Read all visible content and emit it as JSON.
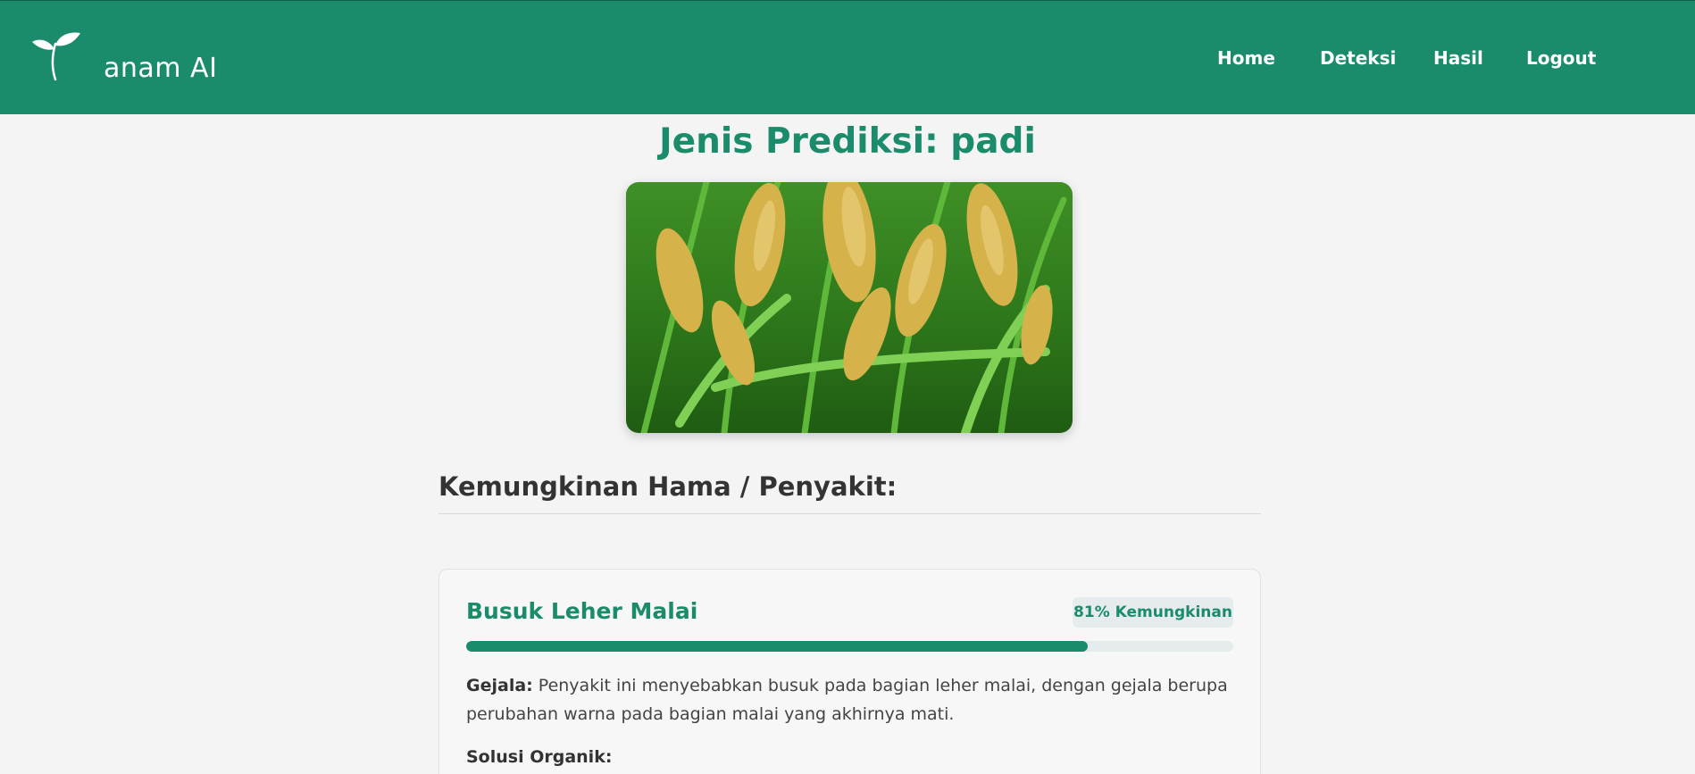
{
  "brand": {
    "name": "anam AI"
  },
  "nav": {
    "items": [
      {
        "label": "Home"
      },
      {
        "label": "Deteksi"
      },
      {
        "label": "Hasil"
      },
      {
        "label": "Logout"
      }
    ]
  },
  "page": {
    "title": "Jenis Prediksi: padi"
  },
  "section": {
    "heading": "Kemungkinan Hama / Penyakit:"
  },
  "results": [
    {
      "name": "Busuk Leher Malai",
      "probability_percent": 81,
      "badge": "81% Kemungkinan",
      "symptom_label": "Gejala:",
      "symptom_text": "Penyakit ini menyebabkan busuk pada bagian leher malai, dengan gejala berupa perubahan warna pada bagian malai yang akhirnya mati.",
      "solution_label": "Solusi Organik:"
    }
  ],
  "colors": {
    "primary": "#1b8c6b",
    "background": "#f4f4f4",
    "badge_bg": "#e6ebee"
  },
  "icons": {
    "logo": "sprout-icon"
  }
}
